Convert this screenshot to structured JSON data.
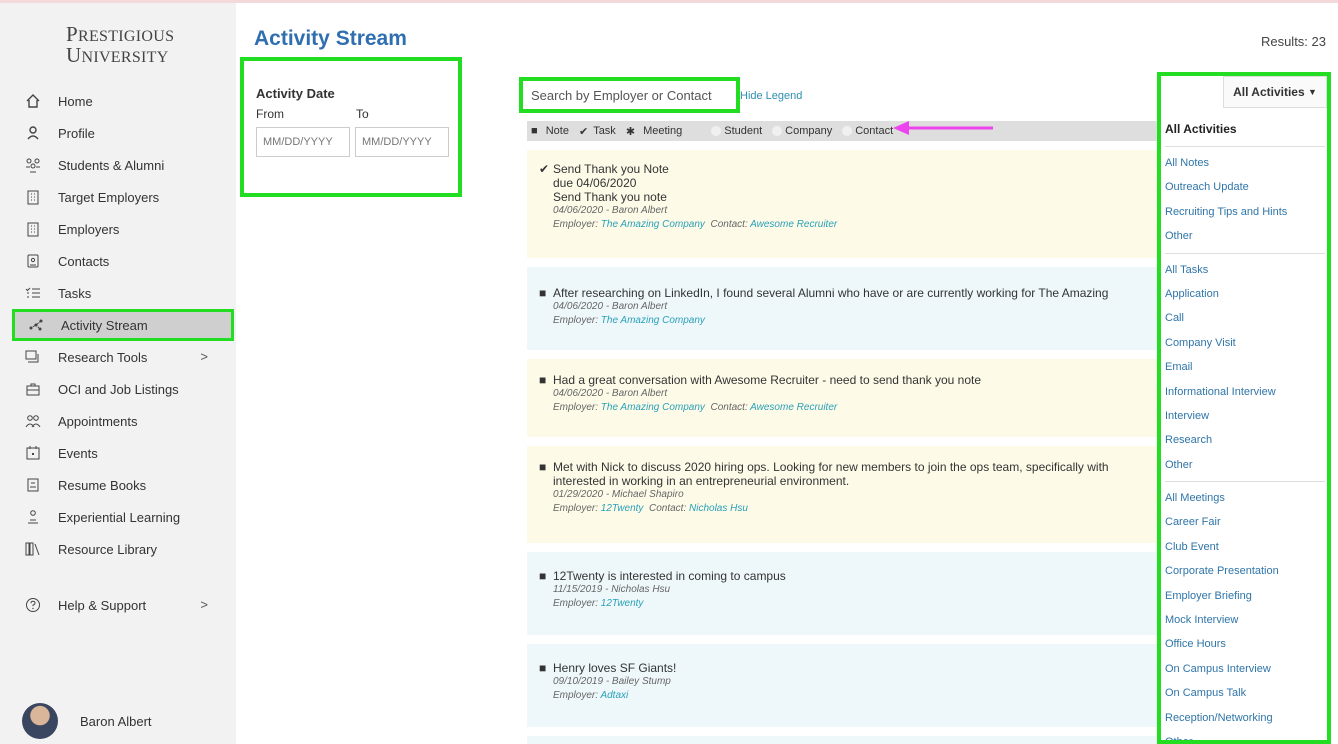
{
  "logo": {
    "line1_big": "P",
    "line1_rest": "RESTIGIOUS",
    "line2_big": "U",
    "line2_rest": "NIVERSITY"
  },
  "sidebar": {
    "items": [
      {
        "label": "Home",
        "icon": "home-icon"
      },
      {
        "label": "Profile",
        "icon": "person-icon"
      },
      {
        "label": "Students & Alumni",
        "icon": "people-icon"
      },
      {
        "label": "Target Employers",
        "icon": "building-icon"
      },
      {
        "label": "Employers",
        "icon": "building-icon"
      },
      {
        "label": "Contacts",
        "icon": "contact-card-icon"
      },
      {
        "label": "Tasks",
        "icon": "task-list-icon"
      },
      {
        "label": "Activity Stream",
        "icon": "activity-icon"
      },
      {
        "label": "Research Tools",
        "icon": "research-icon"
      },
      {
        "label": "OCI and Job Listings",
        "icon": "briefcase-icon"
      },
      {
        "label": "Appointments",
        "icon": "group-icon"
      },
      {
        "label": "Events",
        "icon": "calendar-icon"
      },
      {
        "label": "Resume Books",
        "icon": "book-icon"
      },
      {
        "label": "Experiential Learning",
        "icon": "learning-icon"
      },
      {
        "label": "Resource Library",
        "icon": "library-icon"
      },
      {
        "label": "Help & Support",
        "icon": "help-icon"
      }
    ],
    "user_name": "Baron Albert"
  },
  "header": {
    "title": "Activity Stream",
    "results": "Results: 23"
  },
  "filter": {
    "title": "Activity Date",
    "from_label": "From",
    "to_label": "To",
    "from_placeholder": "MM/DD/YYYY",
    "to_placeholder": "MM/DD/YYYY"
  },
  "search": {
    "placeholder": "Search by Employer or Contact",
    "hide_legend": "Hide Legend"
  },
  "legend": {
    "note": "Note",
    "task": "Task",
    "meeting": "Meeting",
    "student": "Student",
    "company": "Company",
    "contact": "Contact"
  },
  "activities": [
    {
      "title": "Send Thank you Note",
      "due": "due 04/06/2020",
      "body": "Send Thank you note",
      "date_author": "04/06/2020 - Baron Albert",
      "employer_label": "Employer:",
      "employer": "The Amazing Company",
      "contact_label": "Contact:",
      "contact": "Awesome Recruiter"
    },
    {
      "title": "After researching on LinkedIn, I found several Alumni who have or are currently working for The Amazing",
      "date_author": "04/06/2020 - Baron Albert",
      "employer_label": "Employer:",
      "employer": "The Amazing Company"
    },
    {
      "title": "Had a great conversation with Awesome Recruiter - need to send thank you note",
      "date_author": "04/06/2020 - Baron Albert",
      "employer_label": "Employer:",
      "employer": "The Amazing Company",
      "contact_label": "Contact:",
      "contact": "Awesome Recruiter"
    },
    {
      "title": "Met with Nick to discuss 2020 hiring ops. Looking for new members to join the ops team, specifically with",
      "title2": "interested in working in an entrepreneurial environment.",
      "date_author": "01/29/2020 - Michael Shapiro",
      "employer_label": "Employer:",
      "employer": "12Twenty",
      "contact_label": "Contact:",
      "contact": "Nicholas Hsu"
    },
    {
      "title": "12Twenty is interested in coming to campus",
      "date_author": "11/15/2019 - Nicholas Hsu",
      "employer_label": "Employer:",
      "employer": "12Twenty"
    },
    {
      "title": "Henry loves SF Giants!",
      "date_author": "09/10/2019 - Bailey Stump",
      "employer_label": "Employer:",
      "employer": "Adtaxi"
    }
  ],
  "dropdown": {
    "button": "All Activities",
    "header": "All Activities",
    "notes": [
      "All Notes",
      "Outreach Update",
      "Recruiting Tips and Hints",
      "Other"
    ],
    "tasks": [
      "All Tasks",
      "Application",
      "Call",
      "Company Visit",
      "Email",
      "Informational Interview",
      "Interview",
      "Research",
      "Other"
    ],
    "meetings": [
      "All Meetings",
      "Career Fair",
      "Club Event",
      "Corporate Presentation",
      "Employer Briefing",
      "Mock Interview",
      "Office Hours",
      "On Campus Interview",
      "On Campus Talk",
      "Reception/Networking",
      "Other"
    ]
  },
  "colors": {
    "highlight": "#22dd22",
    "accent_blue": "#2f6fb0",
    "link": "#2aa0b8",
    "arrow": "#ee44ee"
  }
}
